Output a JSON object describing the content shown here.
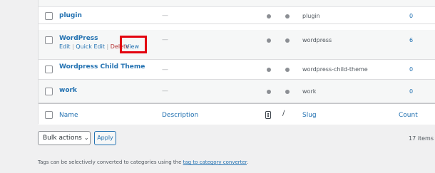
{
  "rows": [
    {
      "name": "plugin",
      "description": "—",
      "slug": "plugin",
      "count": "0"
    },
    {
      "name": "WordPress",
      "description": "—",
      "slug": "wordpress",
      "count": "6",
      "actions": {
        "edit": "Edit",
        "quick_edit": "Quick Edit",
        "delete": "Delete",
        "view": "View",
        "sep": "|"
      }
    },
    {
      "name": "Wordpress Child Theme",
      "description": "—",
      "slug": "wordpress-child-theme",
      "count": "0"
    },
    {
      "name": "work",
      "description": "—",
      "slug": "work",
      "count": "0"
    }
  ],
  "footer_headers": {
    "name": "Name",
    "description": "Description",
    "slug": "Slug",
    "count": "Count"
  },
  "bulk": {
    "label": "Bulk actions",
    "apply": "Apply"
  },
  "items_count": "17 items",
  "footnote": {
    "before": "Tags can be selectively converted to categories using the ",
    "link": "tag to category converter",
    "after": "."
  },
  "colors": {
    "link": "#2271b1",
    "highlight": "#e3000f"
  }
}
